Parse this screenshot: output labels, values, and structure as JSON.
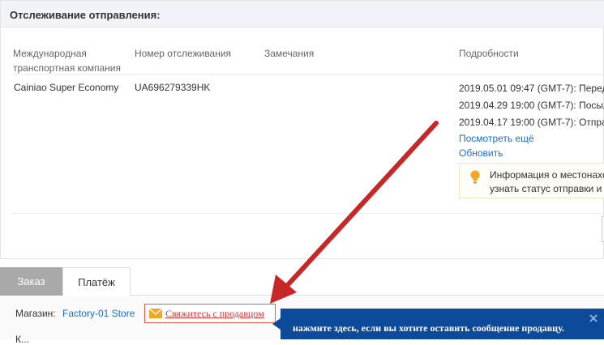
{
  "panel": {
    "title": "Отслеживание отправления:"
  },
  "table": {
    "headers": {
      "company_line1": "Международная",
      "company_line2": "транспортная компания",
      "tracking_number": "Номер отслеживания",
      "remarks": "Замечания",
      "details": "Подробности"
    },
    "row": {
      "company": "Cainiao Super Economy",
      "tracking_number": "UA696279339HK",
      "events": [
        "2019.05.01 09:47 (GMT-7): Перед",
        "2019.04.29 19:00 (GMT-7): Посыл",
        "2019.04.17 19:00 (GMT-7): Отпра"
      ],
      "see_more": "Посмотреть ещё",
      "refresh": "Обновить"
    },
    "info": {
      "line1": "Информация о местонахо",
      "line2": "узнать статус отправки и"
    }
  },
  "tabs": [
    {
      "label": "Заказ",
      "active": true
    },
    {
      "label": "Платёж",
      "active": false
    }
  ],
  "store": {
    "label": "Магазин:",
    "name": "Factory-01 Store",
    "contact_label": "Свяжитесь с продавцом",
    "second_row": "К..."
  },
  "tooltip": {
    "text": "нажмите здесь, если вы хотите оставить сообщение продавцу."
  },
  "colors": {
    "header_bg": "#f1f3f8",
    "link": "#1a6fc7",
    "active_tab": "#a9a9a9",
    "tooltip_bg": "#0d4a99",
    "annotation_arrow": "#c62828",
    "contact_border": "#e4584a"
  }
}
